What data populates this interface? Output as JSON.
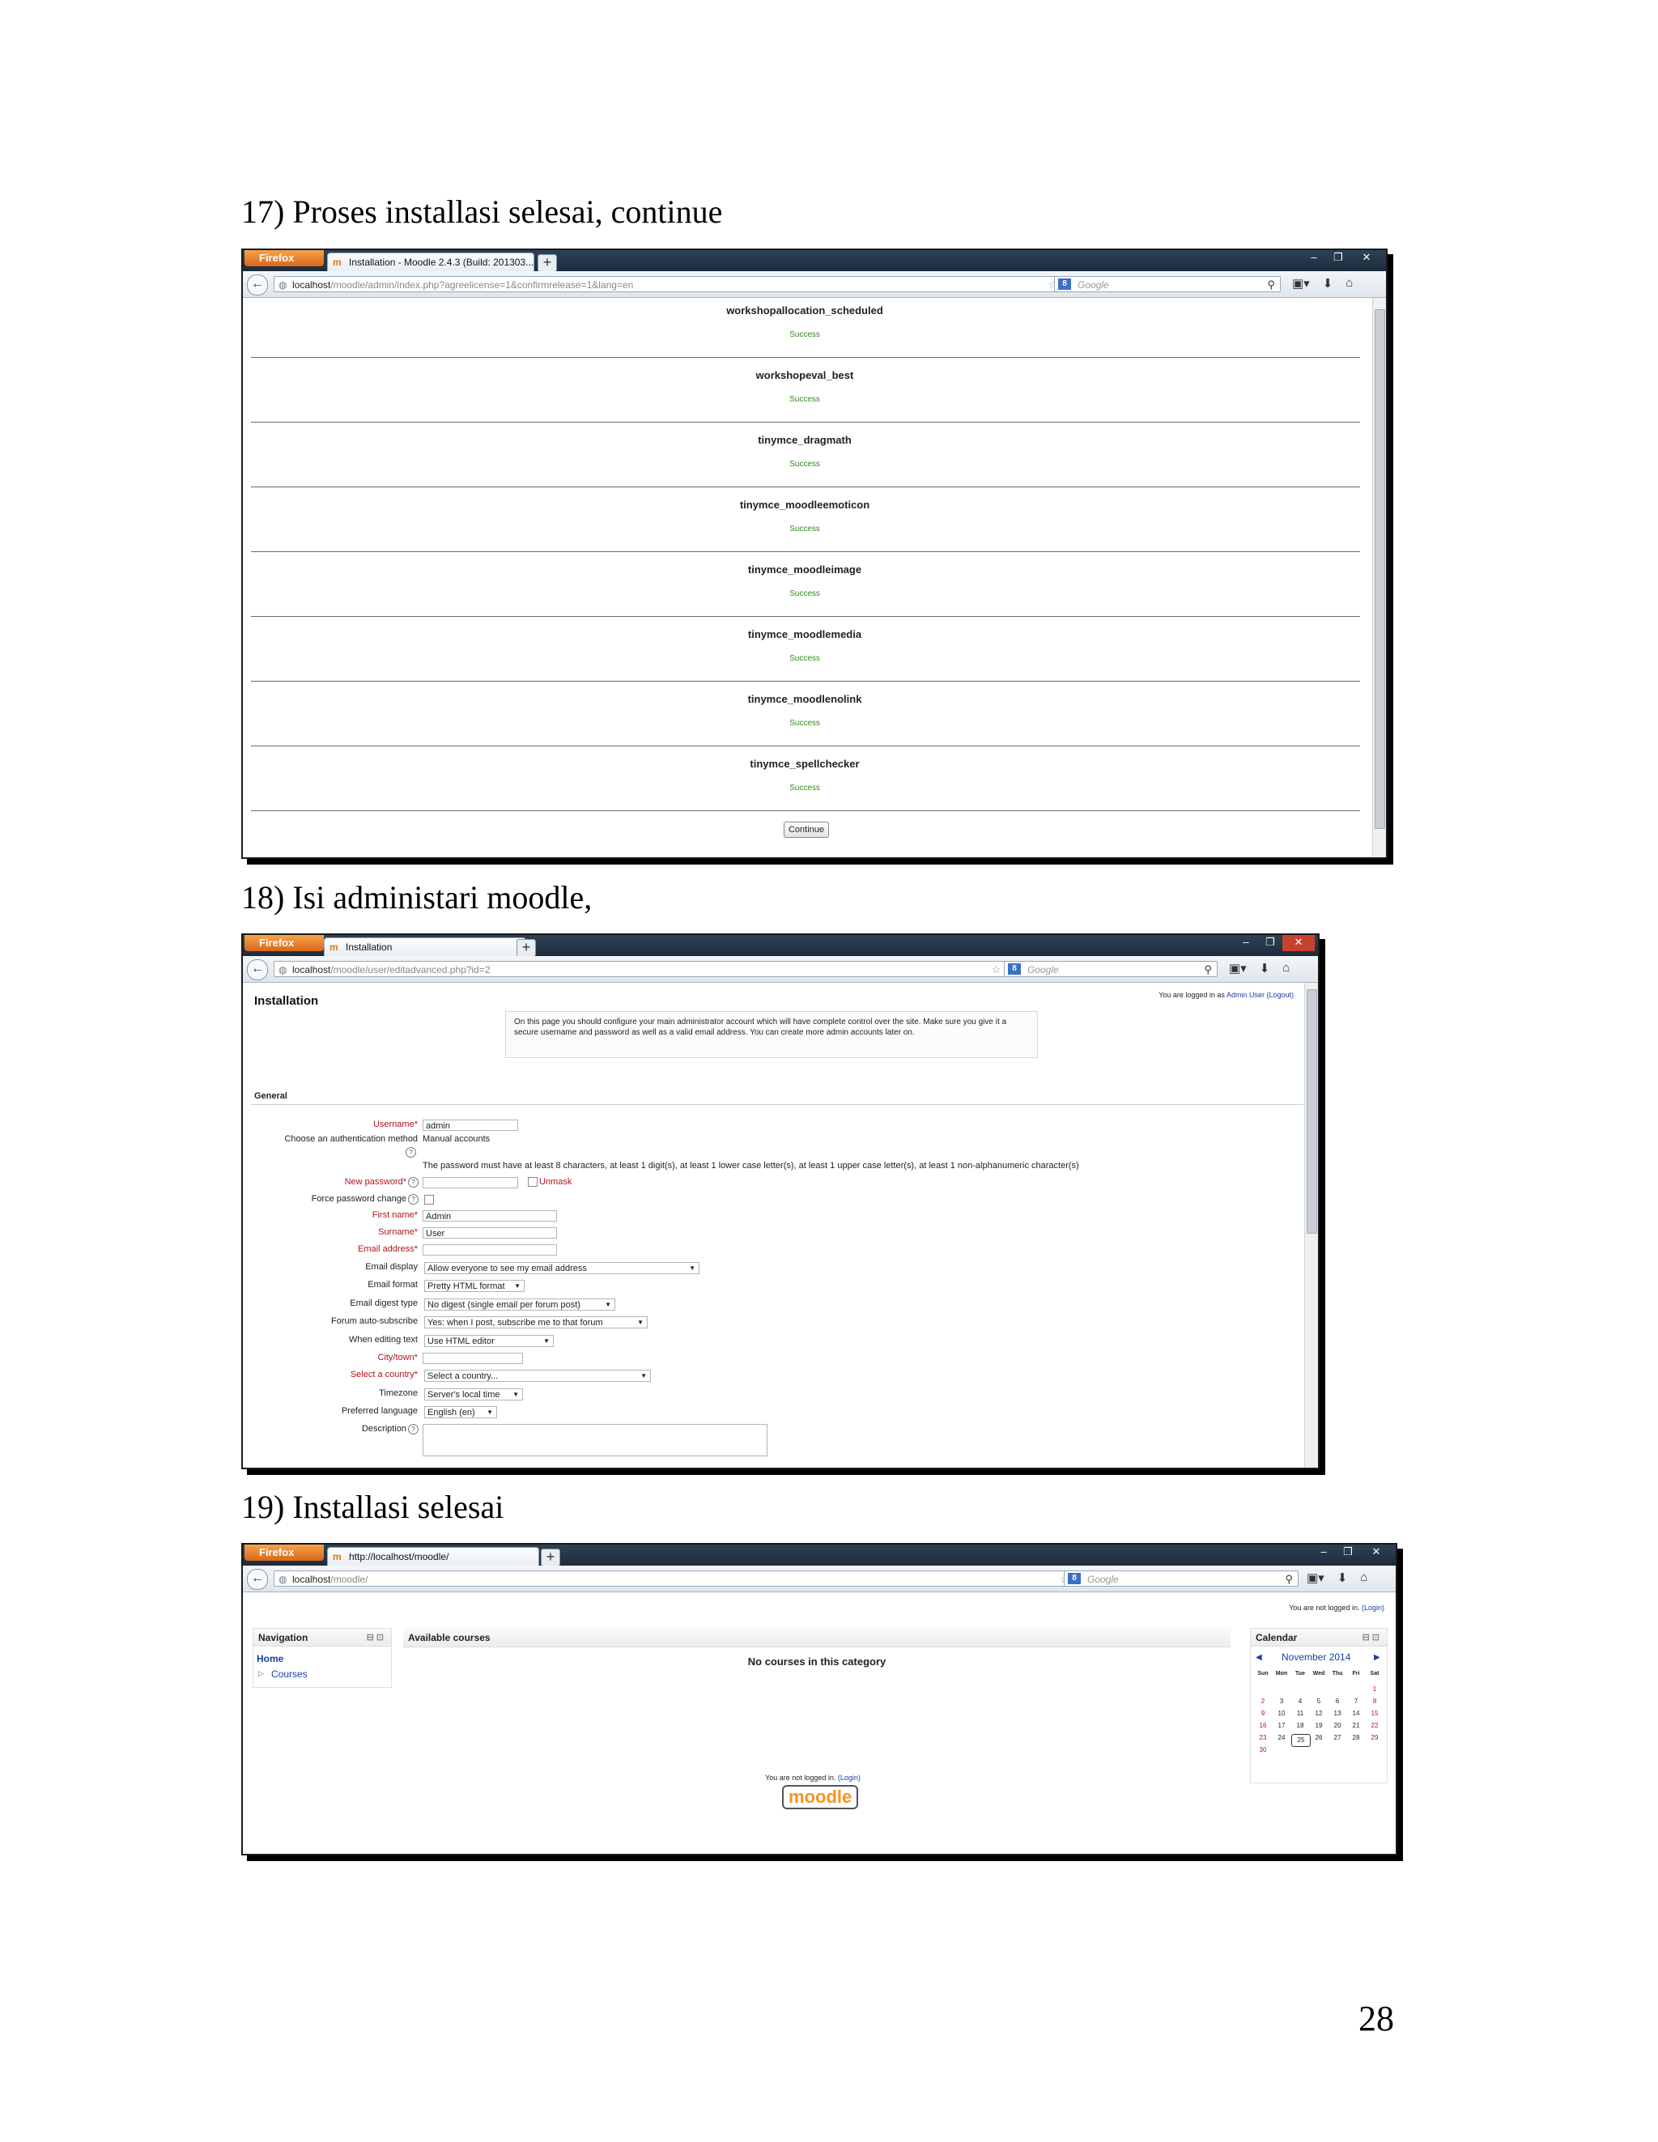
{
  "headings": {
    "step17": "17)  Proses installasi selesai, continue",
    "step18": "18)  Isi administari moodle,",
    "step19": "19)  Installasi selesai"
  },
  "page_number": "28",
  "browser": {
    "firefox_label": "Firefox",
    "search_placeholder": "Google",
    "search_engine_badge": "8"
  },
  "win1": {
    "tab_title": "Installation - Moodle 2.4.3 (Build: 201303...",
    "url_host": "localhost",
    "url_rest": "/moodle/admin/index.php?agreelicense=1&confirmrelease=1&lang=en",
    "plugins": [
      {
        "name": "workshopallocation_scheduled",
        "status": "Success"
      },
      {
        "name": "workshopeval_best",
        "status": "Success"
      },
      {
        "name": "tinymce_dragmath",
        "status": "Success"
      },
      {
        "name": "tinymce_moodleemoticon",
        "status": "Success"
      },
      {
        "name": "tinymce_moodleimage",
        "status": "Success"
      },
      {
        "name": "tinymce_moodlemedia",
        "status": "Success"
      },
      {
        "name": "tinymce_moodlenolink",
        "status": "Success"
      },
      {
        "name": "tinymce_spellchecker",
        "status": "Success"
      }
    ],
    "continue_label": "Continue"
  },
  "win2": {
    "tab_title": "Installation",
    "url_host": "localhost",
    "url_rest": "/moodle/user/editadvanced.php?id=2",
    "page_title": "Installation",
    "login_prefix": "You are logged in as",
    "login_user": "Admin User",
    "logout": "(Logout)",
    "notice": "On this page you should configure your main administrator account which will have complete control over the site. Make sure you give it a secure username and password as well as a valid email address. You can create more admin accounts later on.",
    "section": "General",
    "labels": {
      "username": "Username*",
      "auth": "Choose an authentication method",
      "new_password": "New password*",
      "force_change": "Force password change",
      "first_name": "First name*",
      "surname": "Surname*",
      "email": "Email address*",
      "email_display": "Email display",
      "email_format": "Email format",
      "email_digest": "Email digest type",
      "forum_auto": "Forum auto-subscribe",
      "editing_text": "When editing text",
      "city": "City/town*",
      "country": "Select a country*",
      "timezone": "Timezone",
      "language": "Preferred language",
      "description": "Description"
    },
    "values": {
      "username": "admin",
      "auth": "Manual accounts",
      "password_rule": "The password must have at least 8 characters, at least 1 digit(s), at least 1 lower case letter(s), at least 1 upper case letter(s), at least 1 non-alphanumeric character(s)",
      "unmask": "Unmask",
      "first_name": "Admin",
      "surname": "User",
      "email_display": "Allow everyone to see my email address",
      "email_format": "Pretty HTML format",
      "email_digest": "No digest (single email per forum post)",
      "forum_auto": "Yes: when I post, subscribe me to that forum",
      "editing_text": "Use HTML editor",
      "country": "Select a country...",
      "timezone": "Server's local time",
      "language": "English (en)"
    }
  },
  "win3": {
    "tab_title": "http://localhost/moodle/",
    "url_host": "localhost",
    "url_rest": "/moodle/",
    "login_prefix": "You are not logged in.",
    "login_link": "(Login)",
    "nav_title": "Navigation",
    "nav_home": "Home",
    "nav_courses": "Courses",
    "main_title": "Available courses",
    "no_courses": "No courses in this category",
    "cal_title": "Calendar",
    "cal_month": "November 2014",
    "cal_days": [
      "Sun",
      "Mon",
      "Tue",
      "Wed",
      "Thu",
      "Fri",
      "Sat"
    ],
    "cal_weeks": [
      [
        "",
        "",
        "",
        "",
        "",
        "",
        "1"
      ],
      [
        "2",
        "3",
        "4",
        "5",
        "6",
        "7",
        "8"
      ],
      [
        "9",
        "10",
        "11",
        "12",
        "13",
        "14",
        "15"
      ],
      [
        "16",
        "17",
        "18",
        "19",
        "20",
        "21",
        "22"
      ],
      [
        "23",
        "24",
        "25",
        "26",
        "27",
        "28",
        "29"
      ],
      [
        "30",
        "",
        "",
        "",
        "",
        "",
        ""
      ]
    ],
    "cal_today": "25",
    "footer_prefix": "You are not logged in.",
    "footer_link": "(Login)",
    "logo_text": "moodle"
  }
}
